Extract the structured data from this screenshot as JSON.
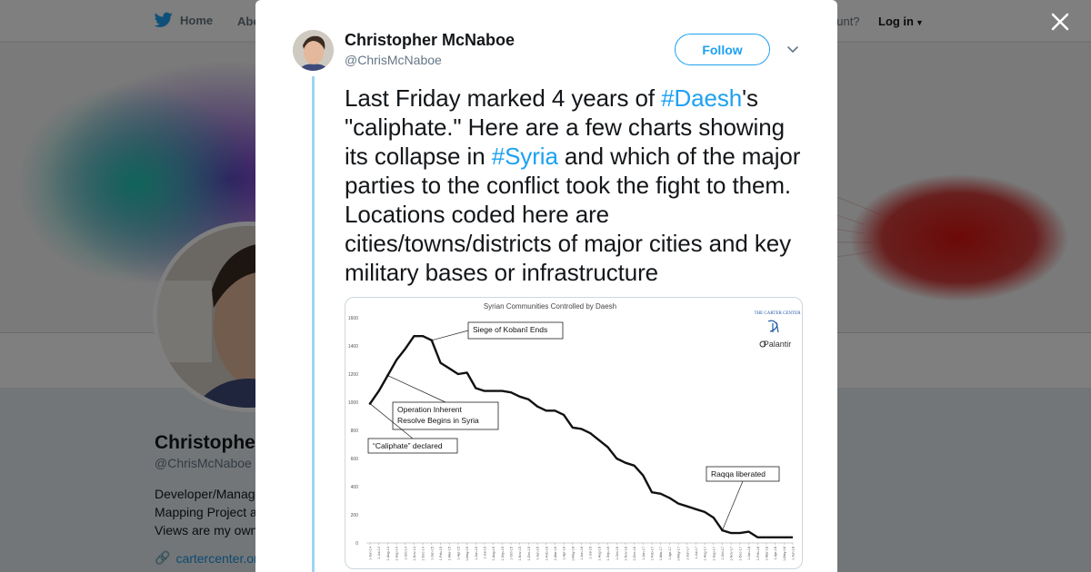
{
  "nav": {
    "home_label": "Home",
    "about_label": "Abo",
    "account_prompt": "ccount?",
    "login_label": "Log in"
  },
  "profile": {
    "name": "Christophe",
    "handle": "@ChrisMcNaboe",
    "bio_lines": [
      "Developer/Manag",
      "Mapping Project a",
      "Views are my own"
    ],
    "link": "cartercenter.or"
  },
  "tweet": {
    "author_name": "Christopher McNaboe",
    "author_handle": "@ChrisMcNaboe",
    "follow_label": "Follow",
    "text_parts": [
      {
        "text": "Last Friday marked 4 years of ",
        "tag": false
      },
      {
        "text": "#Daesh",
        "tag": true
      },
      {
        "text": "'s \"caliphate.\" Here are a few charts showing its collapse in ",
        "tag": false
      },
      {
        "text": "#Syria",
        "tag": true
      },
      {
        "text": " and which of the major parties to the conflict took the fight to them. Locations coded here are cities/towns/districts of major cities and key military bases or infrastructure",
        "tag": false
      }
    ]
  },
  "colors": {
    "twitter_blue": "#1da1f2",
    "link_blue": "#1b95e0",
    "thread_line": "#a0d4f2"
  },
  "chart_data": {
    "type": "line",
    "title": "Syrian Communities Controlled by Daesh",
    "ylim": [
      0,
      1600
    ],
    "yticks": [
      0,
      200,
      400,
      600,
      800,
      1000,
      1200,
      1400,
      1600
    ],
    "x": [
      "1-Jun-14",
      "1-Jul-14",
      "1-Aug-14",
      "1-Sep-14",
      "1-Oct-14",
      "1-Nov-14",
      "1-Dec-14",
      "1-Jan-15",
      "1-Feb-15",
      "1-Mar-15",
      "1-Apr-15",
      "1-May-15",
      "1-Jun-15",
      "1-Jul-15",
      "1-Aug-15",
      "1-Sep-15",
      "1-Oct-15",
      "1-Nov-15",
      "1-Dec-15",
      "1-Jan-16",
      "1-Feb-16",
      "1-Mar-16",
      "1-Apr-16",
      "1-May-16",
      "1-Jun-16",
      "1-Jul-16",
      "1-Aug-16",
      "1-Sep-16",
      "1-Oct-16",
      "1-Nov-16",
      "1-Dec-16",
      "1-Jan-17",
      "1-Feb-17",
      "1-Mar-17",
      "1-Apr-17",
      "1-May-17",
      "1-Jun-17",
      "1-Jul-17",
      "1-Aug-17",
      "1-Sep-17",
      "1-Oct-17",
      "1-Nov-17",
      "1-Dec-17",
      "1-Jan-18",
      "1-Feb-18",
      "1-Mar-18",
      "1-Apr-18",
      "1-May-18",
      "1-Jun-18"
    ],
    "series": [
      {
        "values": [
          990,
          1080,
          1190,
          1300,
          1380,
          1470,
          1470,
          1440,
          1280,
          1240,
          1200,
          1210,
          1100,
          1080,
          1080,
          1080,
          1070,
          1040,
          1020,
          970,
          940,
          940,
          910,
          820,
          810,
          780,
          730,
          680,
          600,
          570,
          550,
          480,
          360,
          350,
          320,
          280,
          260,
          240,
          220,
          180,
          90,
          70,
          70,
          80,
          40,
          40,
          40,
          40,
          40
        ]
      }
    ],
    "annotations": [
      {
        "text": "Siege of Kobanî Ends",
        "x": "1-Jan-15"
      },
      {
        "text": "Operation Inherent Resolve Begins in Syria",
        "x": "1-Aug-14"
      },
      {
        "text": "“Caliphate” declared",
        "x": "1-Jun-14"
      },
      {
        "text": "Raqqa liberated",
        "x": "1-Oct-17"
      }
    ],
    "logos": [
      "THE CARTER CENTER",
      "Palantir"
    ],
    "grid": false
  }
}
